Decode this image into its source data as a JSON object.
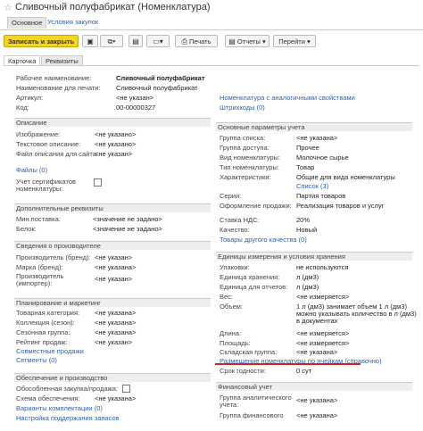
{
  "window": {
    "title": "Сливочный полуфабрикат (Номенклатура)"
  },
  "nav": {
    "tab_main": "Основное",
    "tab_purchase": "Условия закупок"
  },
  "toolbar": {
    "save_close": "Записать и закрыть",
    "print": "Печать",
    "reports": "Отчеты",
    "goto": "Перейти"
  },
  "tabs": {
    "card": "Карточка",
    "requisites": "Реквизиты"
  },
  "card": {
    "work_name_label": "Рабочее наименование:",
    "work_name_value": "Сливочный полуфабрикат",
    "print_name_label": "Наименование для печати:",
    "print_name_value": "Сливочный полуфабрикат",
    "article_label": "Артикул:",
    "article_value": "<не указан>",
    "code_label": "Код:",
    "code_value": "00-00000327",
    "analog_link": "Номенклатура с аналогичными свойствами",
    "barcodes_link": "Штрихкоды (0)"
  },
  "description": {
    "header": "Описание",
    "image_label": "Изображение:",
    "image_value": "<не указано>",
    "text_label": "Текстовое описание:",
    "text_value": "<не указано>",
    "file_label": "Файл описания для сайта:",
    "file_value": "<не указан>",
    "files_link": "Файлы (0)",
    "cert_label_1": "Учет сертификатов",
    "cert_label_2": "номенклатуры:"
  },
  "additional": {
    "header": "Дополнительные реквизиты",
    "min_label": "Мин.поставка:",
    "min_value": "<значение не задано>",
    "protein_label": "Белок:",
    "protein_value": "<значение не задано>"
  },
  "producer": {
    "header": "Сведения о производителе",
    "producer_label": "Производитель (бренд):",
    "producer_value": "<не указан>",
    "brand_label": "Марка (бренд):",
    "brand_value": "<не указана>",
    "importer_label_1": "Производитель",
    "importer_label_2": "(импортер):",
    "importer_value": "<не указан>"
  },
  "planning": {
    "header": "Планирование и маркетинг",
    "category_label": "Товарная категория:",
    "category_value": "<не указана>",
    "collection_label": "Коллекция (сезон):",
    "collection_value": "<не указана>",
    "season_label": "Сезонная группа:",
    "season_value": "<не указана>",
    "rating_label": "Рейтинг продаж:",
    "rating_value": "<не указан>",
    "joint_link": "Совместные продажи",
    "segments_link": "Сегменты (0)"
  },
  "supply": {
    "header": "Обеспечение и производство",
    "separate_label": "Обособленная закупка/продажа:",
    "scheme_label": "Схема обеспечения:",
    "scheme_value": "<не указана>",
    "variants_link": "Варианты комплектации (0)",
    "settings_link": "Настройка поддержания запасов"
  },
  "main_params": {
    "header": "Основные параметры учета",
    "list_group_label": "Группа списка:",
    "list_group_value": "<не указана>",
    "access_group_label": "Группа доступа:",
    "access_group_value": "Прочее",
    "kind_label": "Вид номенклатуры:",
    "kind_value": "Молочное сырье",
    "type_label": "Тип номенклатуры:",
    "type_value": "Товар",
    "char_label": "Характеристики:",
    "char_value": "Общие для вида номенклатуры",
    "char_list_link": "Список (3)",
    "series_label": "Серии:",
    "series_value": "Партия товаров",
    "sale_label": "Оформление продажи:",
    "sale_value": "Реализация товаров и услуг"
  },
  "tax": {
    "vat_label": "Ставка НДС:",
    "vat_value": "20%",
    "quality_label": "Качество:",
    "quality_value": "Новый",
    "other_quality_link": "Товары другого качества (0)"
  },
  "units": {
    "header": "Единицы измерения и условия хранения",
    "packs_label": "Упаковки:",
    "packs_value": "не используются",
    "storage_unit_label": "Единица хранения:",
    "storage_unit_value": "л (дм3)",
    "report_unit_label": "Единица для отчетов:",
    "report_unit_value": "л (дм3)",
    "weight_label": "Вес:",
    "weight_value": "<не измеряется>",
    "volume_label": "Объем:",
    "volume_value_1": "1 л (дм3) занимает объем 1 л (дм3)",
    "volume_value_2": "можно указывать количество в л (дм3)",
    "volume_value_3": "в документах",
    "length_label": "Длина:",
    "length_value": "<не измеряется>",
    "area_label": "Площадь:",
    "area_value": "<не измеряется>",
    "warehouse_label": "Складская группа:",
    "warehouse_value": "<не указана>",
    "cells_link": "Размещение номенклатуры по ячейкам (справочно)",
    "shelf_label": "Срок годности:",
    "shelf_value": "0 сут"
  },
  "finance": {
    "header": "Финансовый учет",
    "analytic_label_1": "Группа аналитического",
    "analytic_label_2": "учета:",
    "analytic_value": "<не указана>",
    "fin_group_label": "Группа финансового",
    "fin_group_value": "<не указана>"
  },
  "colors": {
    "accent": "#f5d51e",
    "link": "#2f5fa7",
    "highlight": "#d42020"
  }
}
